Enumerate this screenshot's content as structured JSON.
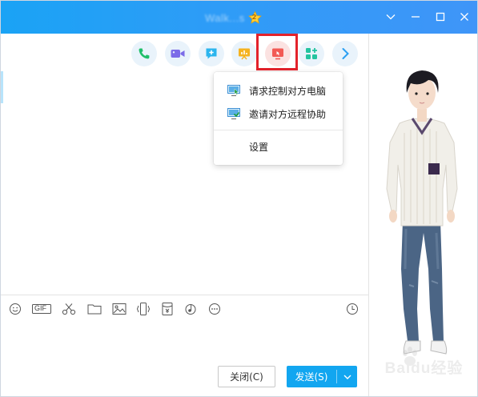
{
  "window": {
    "title": "Walk...s",
    "vip_level": "2",
    "controls": [
      "chevron-down-icon",
      "minimize-icon",
      "maximize-icon",
      "close-icon"
    ]
  },
  "toolbar": {
    "items": [
      {
        "name": "voice-call",
        "icon": "phone-icon",
        "color": "#1fbf6a"
      },
      {
        "name": "video-call",
        "icon": "video-camera-icon",
        "color": "#7b6be8"
      },
      {
        "name": "share-screen",
        "icon": "chat-plus-icon",
        "color": "#2bb5ee"
      },
      {
        "name": "presentation",
        "icon": "presentation-chart-icon",
        "color": "#f5b320"
      },
      {
        "name": "remote-desktop",
        "icon": "remote-desktop-icon",
        "color": "#f25a55"
      },
      {
        "name": "apps",
        "icon": "apps-grid-icon",
        "color": "#24c4a0"
      },
      {
        "name": "more",
        "icon": "chevron-right-icon",
        "color": "#2b9ff2"
      }
    ],
    "highlight_color": "#e3222b"
  },
  "dropdown": {
    "items": [
      {
        "label": "请求控制对方电脑",
        "icon": "request-control-icon"
      },
      {
        "label": "邀请对方远程协助",
        "icon": "invite-assist-icon"
      },
      {
        "label": "设置",
        "icon": ""
      }
    ]
  },
  "input_toolbar": {
    "icons": [
      "emoji-icon",
      "gif-icon",
      "scissors-icon",
      "folder-icon",
      "image-icon",
      "shake-icon",
      "red-packet-icon",
      "music-icon",
      "more-dots-icon"
    ],
    "gif_label": "GIF",
    "history_icon": "clock-icon"
  },
  "footer": {
    "close_label": "关闭(C)",
    "send_label": "发送(S)"
  },
  "watermark": {
    "text": "Baidu经验"
  }
}
